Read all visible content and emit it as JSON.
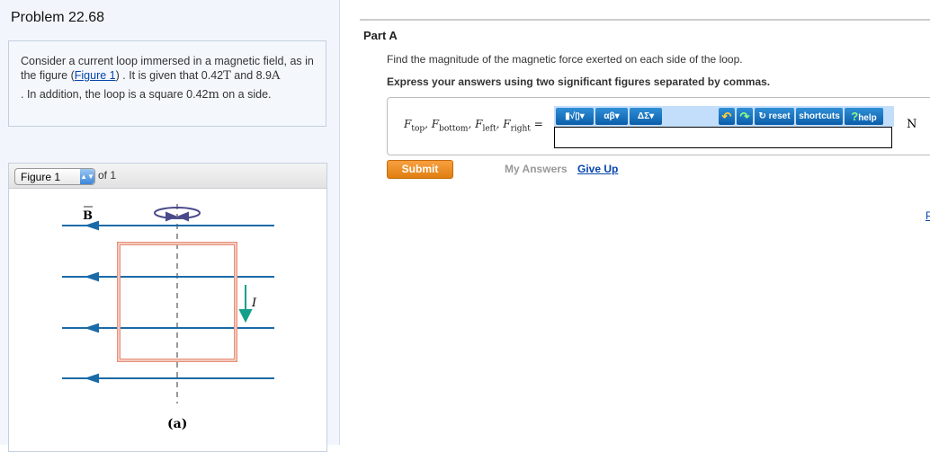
{
  "problem": {
    "title": "Problem 22.68",
    "text1": "Consider a current loop immersed in a magnetic field, as in the figure (",
    "figure_link": "Figure 1",
    "text2": ") . It is given that 0.42",
    "unit_T": "T",
    "text3": " and 8.9",
    "unit_A": "A",
    "text4": ". In addition, the loop is a square 0.42",
    "unit_m": "m",
    "text5": " on a side."
  },
  "figure": {
    "select_value": "Figure 1",
    "of_label": "of 1",
    "b_label": "B",
    "i_label": "I",
    "caption": "(a)"
  },
  "part": {
    "title": "Part A",
    "question": "Find the magnitude of the magnetic force exerted on each side of the loop.",
    "instruction": "Express your answers using two significant figures separated by commas.",
    "lhs": {
      "f": "F",
      "top": "top",
      "bottom": "bottom",
      "left": "left",
      "right": "right",
      "eq": "="
    },
    "toolbar": {
      "templates": "▮√▯",
      "greek": "αβ",
      "symbols": "ΔΣ",
      "undo": "↶",
      "redo": "↷",
      "reset": "reset",
      "shortcuts": "shortcuts",
      "help": "help"
    },
    "answer_value": "",
    "unit": "N",
    "submit": "Submit",
    "my_answers": "My Answers",
    "give_up": "Give Up",
    "feedback": "P"
  }
}
